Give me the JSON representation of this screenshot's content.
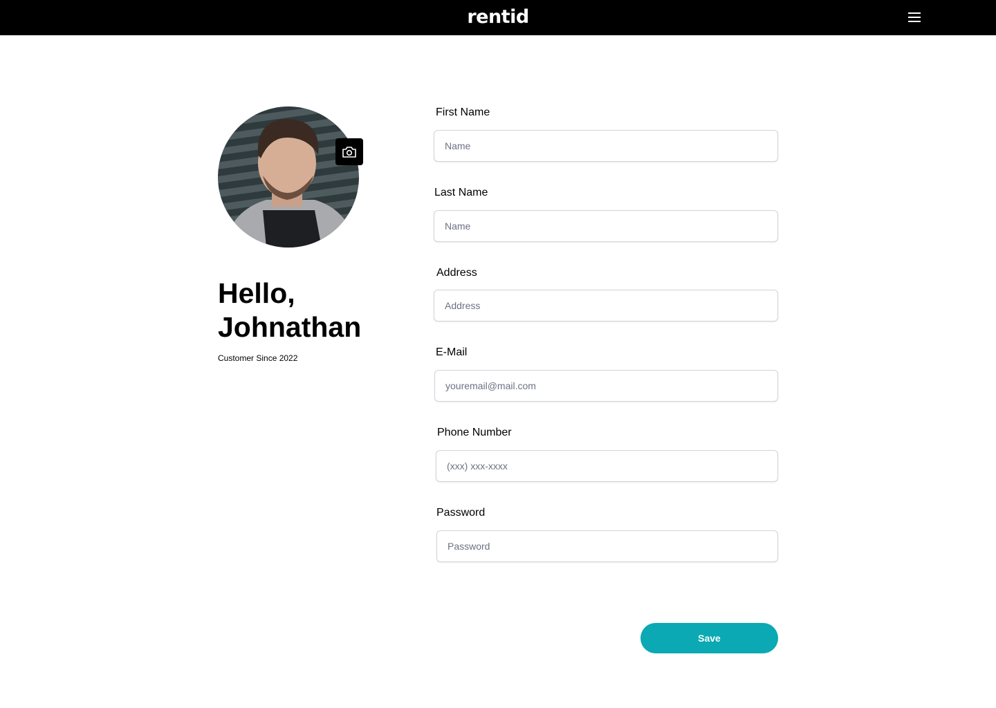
{
  "header": {
    "logo": "rentid",
    "menu_icon": "hamburger-icon"
  },
  "profile": {
    "greeting": "Hello,",
    "name": "Johnathan",
    "customer_since": "Customer Since 2022",
    "camera_icon": "camera-icon"
  },
  "form": {
    "fields": [
      {
        "label": "First Name",
        "placeholder": "Name"
      },
      {
        "label": "Last Name",
        "placeholder": "Name"
      },
      {
        "label": "Address",
        "placeholder": "Address"
      },
      {
        "label": "E-Mail",
        "placeholder": "youremail@mail.com"
      },
      {
        "label": "Phone Number",
        "placeholder": "(xxx) xxx-xxxx"
      },
      {
        "label": "Password",
        "placeholder": "Password"
      }
    ],
    "save_label": "Save"
  },
  "colors": {
    "accent": "#0aa9b3",
    "header": "#000000"
  }
}
